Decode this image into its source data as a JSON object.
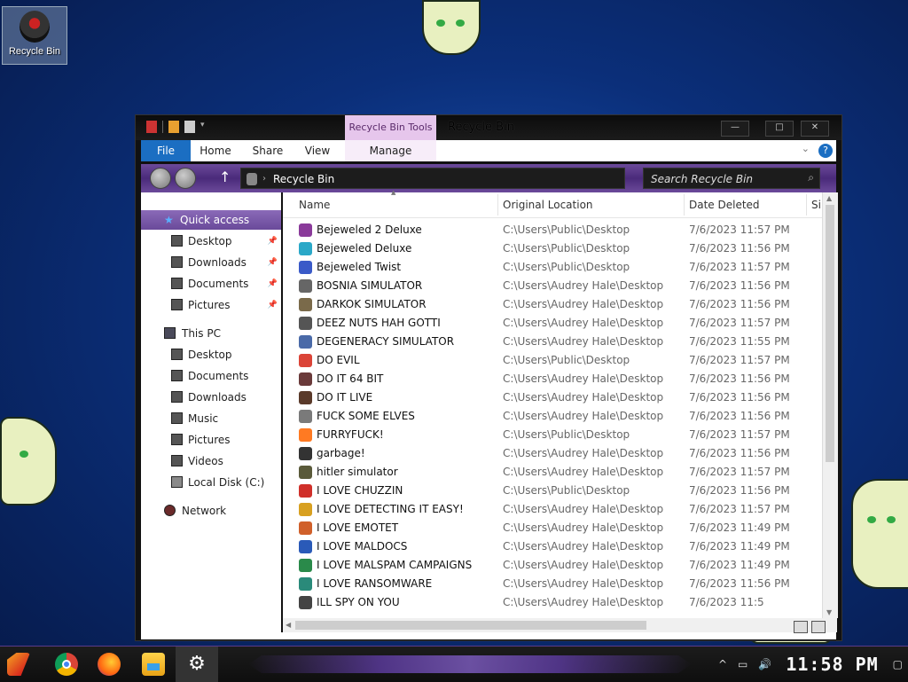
{
  "desktop": {
    "icon_label": "Recycle Bin"
  },
  "window": {
    "title": "Recycle Bin",
    "tools_tab": "Recycle Bin Tools",
    "controls": {
      "minimize": "—",
      "maximize": "□",
      "close": "✕"
    }
  },
  "ribbon": {
    "file": "File",
    "home": "Home",
    "share": "Share",
    "view": "View",
    "manage": "Manage",
    "help": "?"
  },
  "address": {
    "path": "Recycle Bin",
    "search_placeholder": "Search Recycle Bin"
  },
  "nav": {
    "quick_access": "Quick access",
    "quick_items": [
      "Desktop",
      "Downloads",
      "Documents",
      "Pictures"
    ],
    "this_pc": "This PC",
    "pc_items": [
      "Desktop",
      "Documents",
      "Downloads",
      "Music",
      "Pictures",
      "Videos",
      "Local Disk (C:)"
    ],
    "network": "Network"
  },
  "columns": {
    "name": "Name",
    "original_location": "Original Location",
    "date_deleted": "Date Deleted",
    "size_trunc": "Si"
  },
  "files": [
    {
      "name": "Bejeweled 2 Deluxe",
      "location": "C:\\Users\\Public\\Desktop",
      "date": "7/6/2023 11:57 PM",
      "icon_color": "#8a3a9a"
    },
    {
      "name": "Bejeweled Deluxe",
      "location": "C:\\Users\\Public\\Desktop",
      "date": "7/6/2023 11:56 PM",
      "icon_color": "#2aa8c8"
    },
    {
      "name": "Bejeweled Twist",
      "location": "C:\\Users\\Public\\Desktop",
      "date": "7/6/2023 11:57 PM",
      "icon_color": "#3a5ac8"
    },
    {
      "name": "BOSNIA SIMULATOR",
      "location": "C:\\Users\\Audrey Hale\\Desktop",
      "date": "7/6/2023 11:56 PM",
      "icon_color": "#666666"
    },
    {
      "name": "DARKOK SIMULATOR",
      "location": "C:\\Users\\Audrey Hale\\Desktop",
      "date": "7/6/2023 11:56 PM",
      "icon_color": "#7a6a4a"
    },
    {
      "name": "DEEZ NUTS HAH GOTTI",
      "location": "C:\\Users\\Audrey Hale\\Desktop",
      "date": "7/6/2023 11:57 PM",
      "icon_color": "#555555"
    },
    {
      "name": "DEGENERACY SIMULATOR",
      "location": "C:\\Users\\Audrey Hale\\Desktop",
      "date": "7/6/2023 11:55 PM",
      "icon_color": "#4a6aa8"
    },
    {
      "name": "DO EVIL",
      "location": "C:\\Users\\Public\\Desktop",
      "date": "7/6/2023 11:57 PM",
      "icon_color": "#db4437"
    },
    {
      "name": "DO IT 64 BIT",
      "location": "C:\\Users\\Audrey Hale\\Desktop",
      "date": "7/6/2023 11:56 PM",
      "icon_color": "#6a3a3a"
    },
    {
      "name": "DO IT LIVE",
      "location": "C:\\Users\\Audrey Hale\\Desktop",
      "date": "7/6/2023 11:56 PM",
      "icon_color": "#5a3a2a"
    },
    {
      "name": "FUCK SOME ELVES",
      "location": "C:\\Users\\Audrey Hale\\Desktop",
      "date": "7/6/2023 11:56 PM",
      "icon_color": "#7a7a7a"
    },
    {
      "name": "FURRYFUCK!",
      "location": "C:\\Users\\Public\\Desktop",
      "date": "7/6/2023 11:57 PM",
      "icon_color": "#ff7a22"
    },
    {
      "name": "garbage!",
      "location": "C:\\Users\\Audrey Hale\\Desktop",
      "date": "7/6/2023 11:56 PM",
      "icon_color": "#333333"
    },
    {
      "name": "hitler simulator",
      "location": "C:\\Users\\Audrey Hale\\Desktop",
      "date": "7/6/2023 11:57 PM",
      "icon_color": "#5a5a3a"
    },
    {
      "name": "I LOVE CHUZZIN",
      "location": "C:\\Users\\Public\\Desktop",
      "date": "7/6/2023 11:56 PM",
      "icon_color": "#d0302a"
    },
    {
      "name": "I LOVE DETECTING IT EASY!",
      "location": "C:\\Users\\Audrey Hale\\Desktop",
      "date": "7/6/2023 11:57 PM",
      "icon_color": "#d8a020"
    },
    {
      "name": "I LOVE EMOTET",
      "location": "C:\\Users\\Audrey Hale\\Desktop",
      "date": "7/6/2023 11:49 PM",
      "icon_color": "#d0602a"
    },
    {
      "name": "I LOVE MALDOCS",
      "location": "C:\\Users\\Audrey Hale\\Desktop",
      "date": "7/6/2023 11:49 PM",
      "icon_color": "#2a5ab8"
    },
    {
      "name": "I LOVE MALSPAM CAMPAIGNS",
      "location": "C:\\Users\\Audrey Hale\\Desktop",
      "date": "7/6/2023 11:49 PM",
      "icon_color": "#2a8a4a"
    },
    {
      "name": "I LOVE RANSOMWARE",
      "location": "C:\\Users\\Audrey Hale\\Desktop",
      "date": "7/6/2023 11:56 PM",
      "icon_color": "#2a8a7a"
    },
    {
      "name": "ILL SPY ON YOU",
      "location": "C:\\Users\\Audrey Hale\\Desktop",
      "date": "7/6/2023 11:5",
      "icon_color": "#444444"
    }
  ],
  "taskbar": {
    "settings_glyph": "⚙",
    "tray_up": "^",
    "clock": "11:58 PM"
  }
}
